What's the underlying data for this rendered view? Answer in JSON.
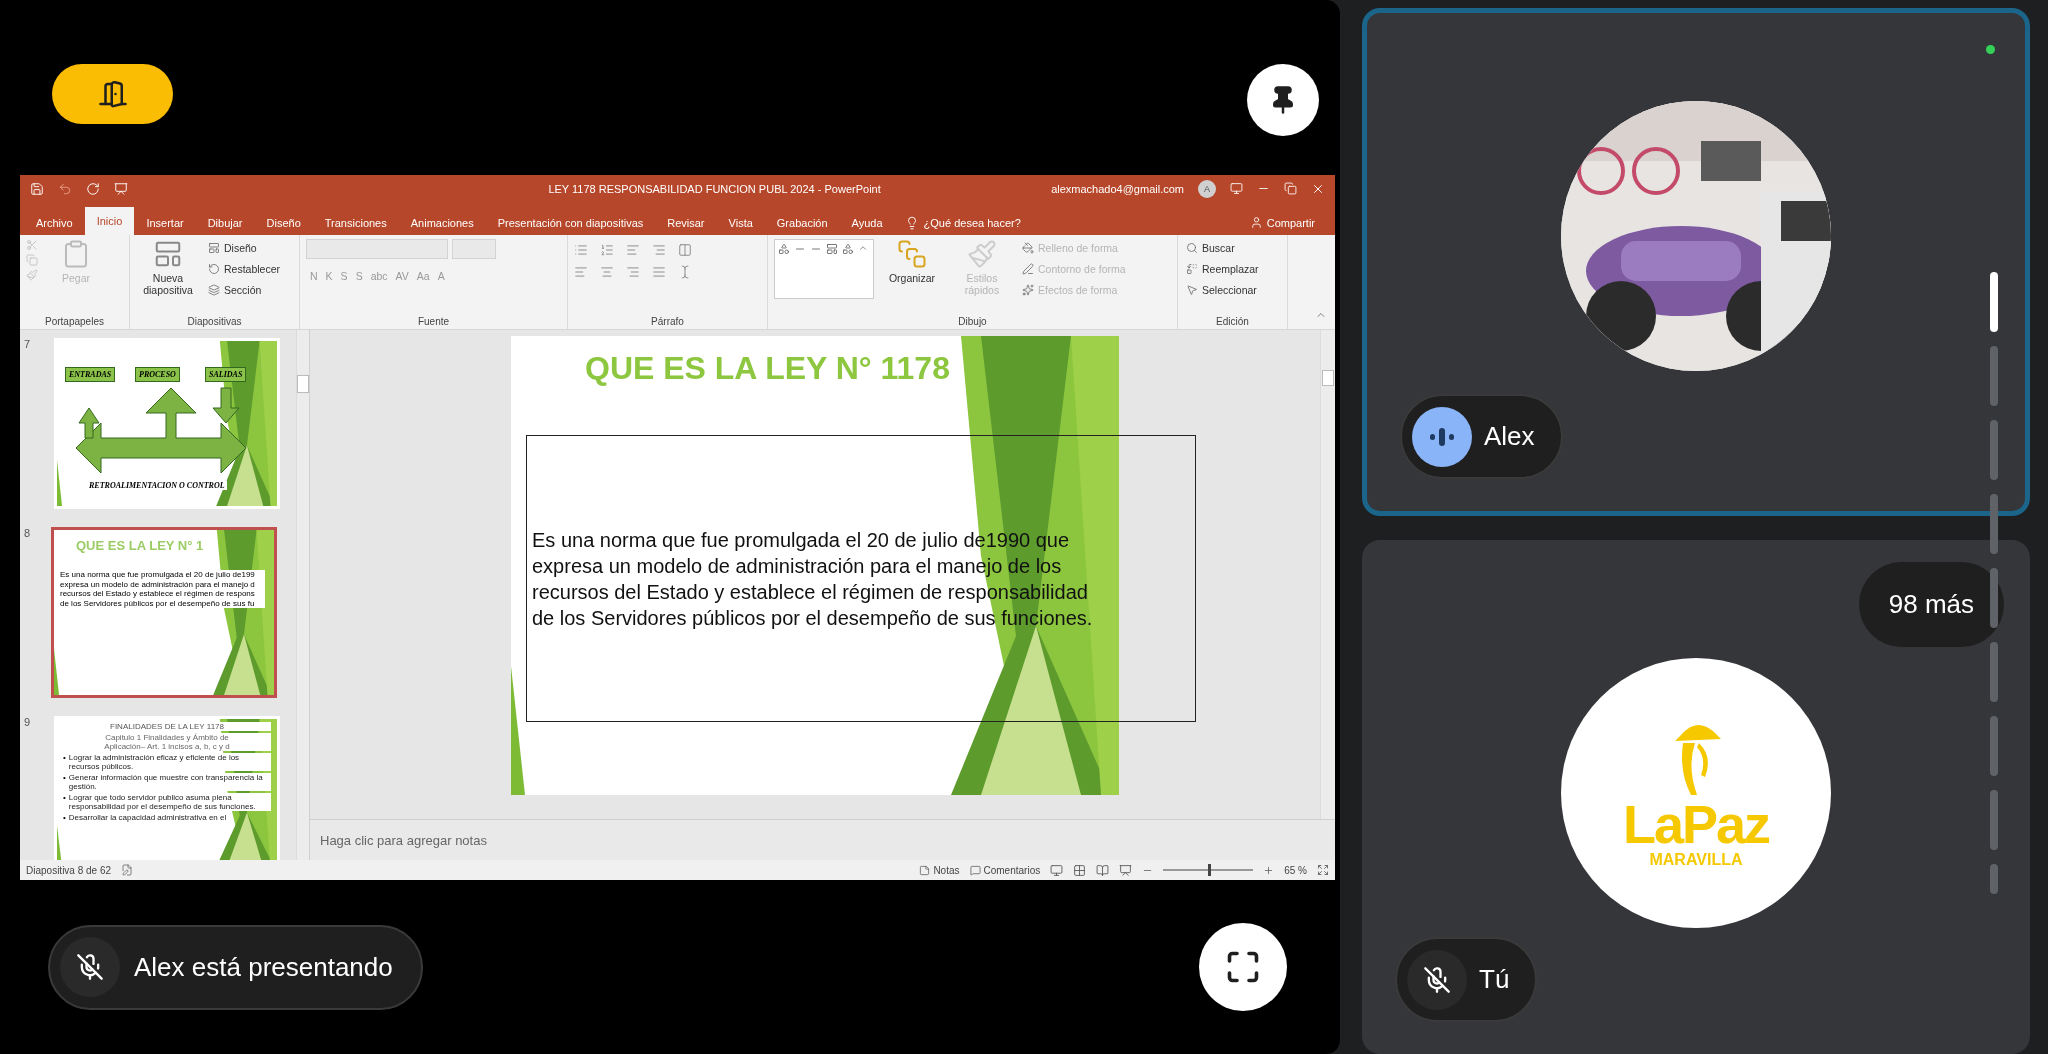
{
  "meeting": {
    "presentation": {
      "window": {
        "title": "LEY 1178 RESPONSABILIDAD FUNCION PUBL 2024  -  PowerPoint",
        "account": "alexmachado4@gmail.com",
        "avatar_initial": "A"
      },
      "tabs": [
        {
          "label": "Archivo",
          "selected": false
        },
        {
          "label": "Inicio",
          "selected": true
        },
        {
          "label": "Insertar",
          "selected": false
        },
        {
          "label": "Dibujar",
          "selected": false
        },
        {
          "label": "Diseño",
          "selected": false
        },
        {
          "label": "Transiciones",
          "selected": false
        },
        {
          "label": "Animaciones",
          "selected": false
        },
        {
          "label": "Presentación con diapositivas",
          "selected": false
        },
        {
          "label": "Revisar",
          "selected": false
        },
        {
          "label": "Vista",
          "selected": false
        },
        {
          "label": "Grabación",
          "selected": false
        },
        {
          "label": "Ayuda",
          "selected": false
        }
      ],
      "tell_me": "¿Qué desea hacer?",
      "share": "Compartir",
      "ribbon_groups": [
        {
          "name": "Portapapeles",
          "kind": "clipboard",
          "large": [
            {
              "label": "Pegar",
              "disabled": true
            }
          ]
        },
        {
          "name": "Diapositivas",
          "kind": "slides",
          "large": [
            {
              "label": "Nueva diapositiva",
              "disabled": false
            }
          ],
          "small": [
            {
              "label": "Diseño",
              "disabled": false
            },
            {
              "label": "Restablecer",
              "disabled": false
            },
            {
              "label": "Sección",
              "disabled": false
            }
          ]
        },
        {
          "name": "Fuente",
          "kind": "font",
          "letters": [
            "N",
            "K",
            "S",
            "S",
            "abc",
            "AV",
            "Aa",
            "A"
          ]
        },
        {
          "name": "Párrafo",
          "kind": "paragraph"
        },
        {
          "name": "Dibujo",
          "kind": "drawing",
          "large": [
            {
              "label": "Organizar",
              "disabled": false
            },
            {
              "label": "Estilos rápidos",
              "disabled": true
            }
          ],
          "small": [
            {
              "label": "Relleno de forma",
              "disabled": true
            },
            {
              "label": "Contorno de forma",
              "disabled": true
            },
            {
              "label": "Efectos de forma",
              "disabled": true
            }
          ]
        },
        {
          "name": "Edición",
          "kind": "editing",
          "small": [
            {
              "label": "Buscar",
              "disabled": false
            },
            {
              "label": "Reemplazar",
              "disabled": false
            },
            {
              "label": "Seleccionar",
              "disabled": false
            }
          ]
        }
      ],
      "slides": [
        {
          "number": "7",
          "selected": false,
          "kind": "diagram",
          "labels": [
            "ENTRADAS",
            "PROCESO",
            "SALIDAS"
          ],
          "footer": "RETROALIMENTACION O CONTROL"
        },
        {
          "number": "8",
          "selected": true,
          "kind": "text",
          "title": "QUE ES LA LEY N° 1",
          "lines": [
            "Es una norma que fue promulgada  el 20 de julio de199",
            "expresa un modelo de administración para el manejo d",
            "recursos del Estado y establece el régimen de respons",
            "de los Servidores públicos por el desempeño de sus fu"
          ]
        },
        {
          "number": "9",
          "selected": false,
          "kind": "bullets",
          "title": "FINALIDADES  DE LA LEY 1178",
          "subtitle_lines": [
            "Capitulo  1 Finalidades y Ámbito de",
            "Aplicación– Art.  1 incisos a, b, c y d"
          ],
          "bullet_mark": "•",
          "bullets": [
            "Lograr la administración eficaz y eficiente de los recursos públicos.",
            "Generar información que muestre con transparencia la gestión.",
            "Lograr que todo servidor publico asuma plena responsabilidad por el desempeño de sus funciones.",
            "Desarrollar la capacidad administrativa en el"
          ]
        }
      ],
      "current_slide": {
        "title": "QUE ES LA LEY N° 1178",
        "body_lines": [
          "Es una norma que fue promulgada  el 20 de julio de1990 que",
          "expresa un modelo de administración para el manejo de los",
          "recursos del Estado y establece el régimen de responsabilidad",
          "de los Servidores públicos por el desempeño de sus funciones."
        ]
      },
      "notes_placeholder": "Haga clic para agregar notas",
      "status_bar": {
        "slide_counter": "Diapositiva 8 de 62",
        "notes": "Notas",
        "comments": "Comentarios",
        "zoom": {
          "level": 0.5,
          "reading": "65 %"
        }
      }
    },
    "presenter": {
      "label": "Alex está presentando",
      "muted": true
    },
    "participants": [
      {
        "name": "Alex",
        "active": true,
        "speaking": true
      },
      {
        "name": "Tú",
        "kind": "logo",
        "active": false,
        "speaking": false,
        "muted": true,
        "logo": {
          "wordmark": "LaPaz",
          "tagline": "MARAVILLA"
        }
      }
    ],
    "more_count": "98 más"
  }
}
